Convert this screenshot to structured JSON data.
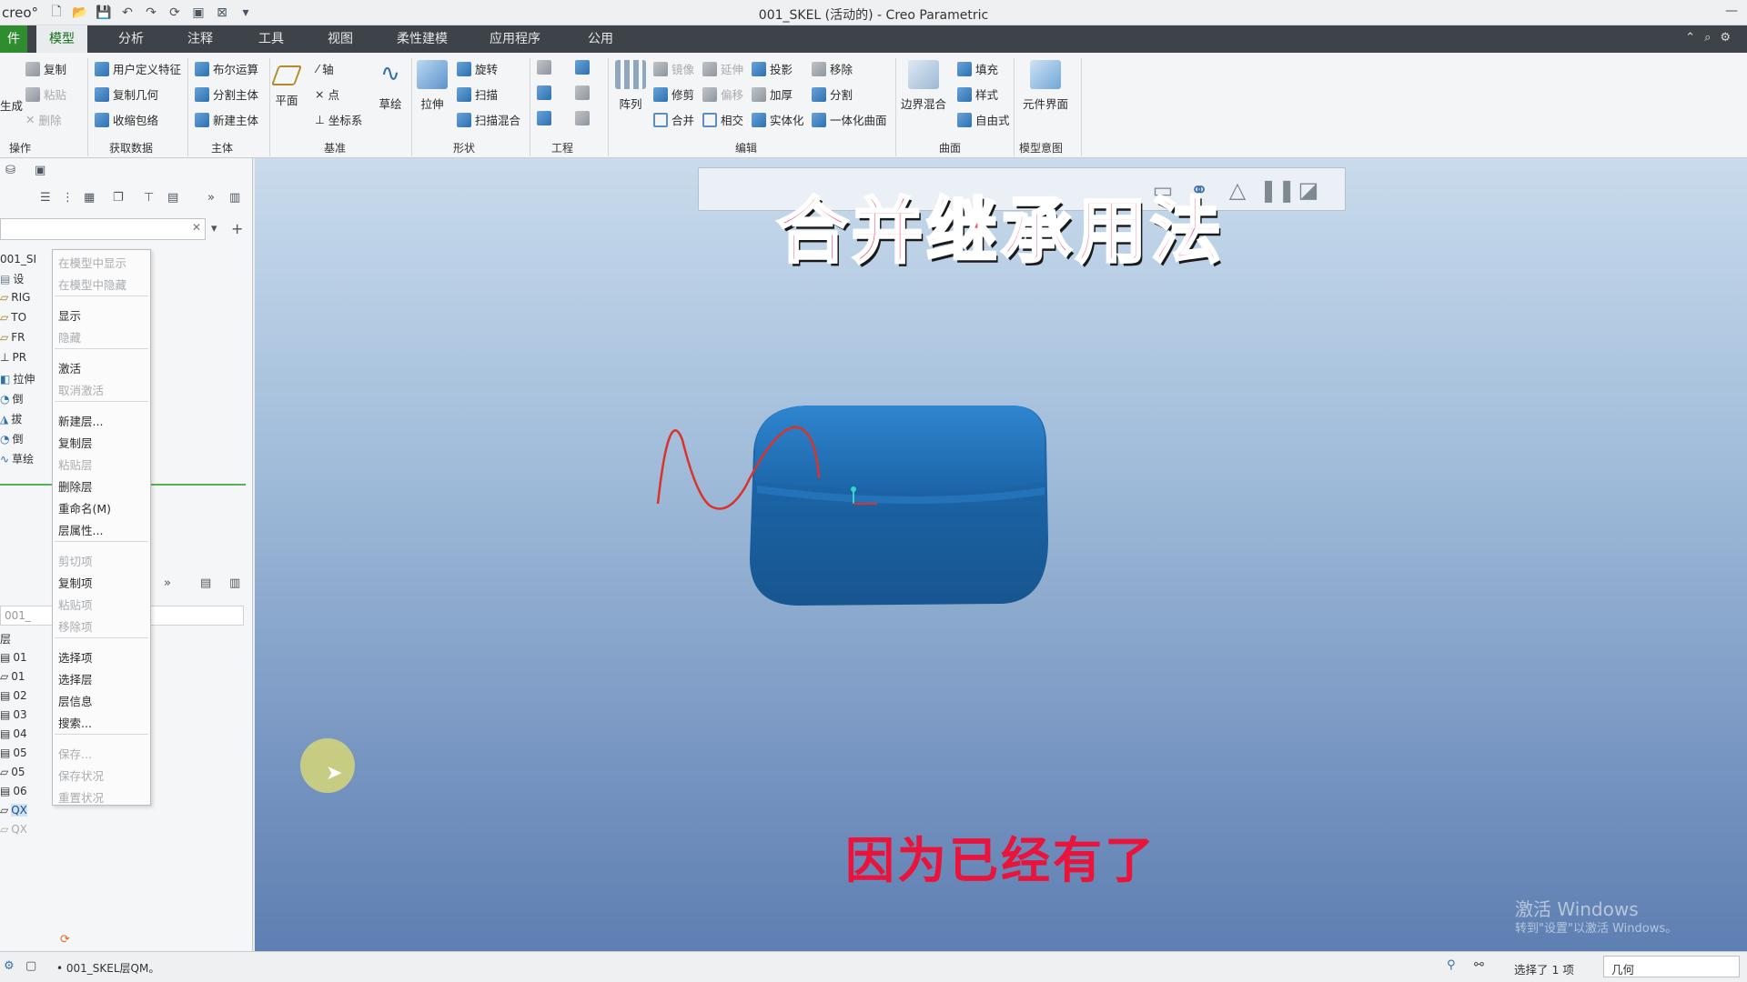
{
  "app": {
    "logo_text": "creo°",
    "window_title": "001_SKEL (活动的) - Creo Parametric"
  },
  "tabs": {
    "file": "件",
    "items": [
      "模型",
      "分析",
      "注释",
      "工具",
      "视图",
      "柔性建模",
      "应用程序",
      "公用"
    ],
    "active": "模型"
  },
  "ribbon": {
    "ops": {
      "regen": "生成",
      "copy": "复制",
      "paste": "粘贴",
      "delete": "删除",
      "label": "操作"
    },
    "get_data": {
      "udf": "用户定义特征",
      "copy_geom": "复制几何",
      "shrinkwrap": "收缩包络",
      "label": "获取数据"
    },
    "body": {
      "boolean": "布尔运算",
      "split_body": "分割主体",
      "new_body": "新建主体",
      "label": "主体"
    },
    "datum": {
      "plane": "平面",
      "axis": "轴",
      "point": "点",
      "csys": "坐标系",
      "sketch": "草绘",
      "label": "基准"
    },
    "shapes": {
      "extrude": "拉伸",
      "revolve": "旋转",
      "sweep": "扫描",
      "swept_blend": "扫描混合",
      "label": "形状"
    },
    "engineering": {
      "label": "工程"
    },
    "editing": {
      "pattern": "阵列",
      "mirror": "镜像",
      "extend": "延伸",
      "project": "投影",
      "trim": "修剪",
      "offset": "偏移",
      "thicken": "加厚",
      "merge": "合并",
      "intersect": "相交",
      "solidify": "实体化",
      "remove": "移除",
      "split": "分割",
      "unify": "一体化曲面",
      "label": "编辑"
    },
    "surfaces": {
      "boundary": "边界混合",
      "fill": "填充",
      "style": "样式",
      "freestyle": "自由式",
      "label": "曲面"
    },
    "model_intent": {
      "component_interface": "元件界面",
      "label": "模型意图"
    }
  },
  "tree": {
    "root": "001_SI",
    "rows": [
      "设",
      "RIG",
      "TO",
      "FR",
      "PR",
      "拉伸",
      "倒",
      "拔",
      "倒",
      "草绘"
    ],
    "layer_header": "层",
    "layer_select": "001_",
    "layers": [
      "01",
      "01",
      "02",
      "03",
      "04",
      "05",
      "05",
      "06",
      "QX",
      "QX"
    ]
  },
  "context_menu": {
    "items": [
      {
        "label": "在模型中显示",
        "enabled": false
      },
      {
        "label": "在模型中隐藏",
        "enabled": false
      },
      {
        "label": "显示",
        "enabled": true
      },
      {
        "label": "隐藏",
        "enabled": false
      },
      {
        "label": "激活",
        "enabled": true
      },
      {
        "label": "取消激活",
        "enabled": false
      },
      {
        "label": "新建层...",
        "enabled": true
      },
      {
        "label": "复制层",
        "enabled": true
      },
      {
        "label": "粘贴层",
        "enabled": false
      },
      {
        "label": "删除层",
        "enabled": true
      },
      {
        "label": "重命名(M)",
        "enabled": true
      },
      {
        "label": "层属性...",
        "enabled": true
      },
      {
        "label": "剪切项",
        "enabled": false
      },
      {
        "label": "复制项",
        "enabled": true
      },
      {
        "label": "粘贴项",
        "enabled": false
      },
      {
        "label": "移除项",
        "enabled": false
      },
      {
        "label": "选择项",
        "enabled": true
      },
      {
        "label": "选择层",
        "enabled": true
      },
      {
        "label": "层信息",
        "enabled": true
      },
      {
        "label": "搜索...",
        "enabled": true
      },
      {
        "label": "保存...",
        "enabled": false
      },
      {
        "label": "保存状况",
        "enabled": false
      },
      {
        "label": "重置状况",
        "enabled": false
      }
    ]
  },
  "overlay": {
    "title": "合并继承用法",
    "subtitle": "因为已经有了"
  },
  "watermark": {
    "line1": "激活 Windows",
    "line2": "转到\"设置\"以激活 Windows。"
  },
  "status": {
    "message": "• 001_SKEL层QM。",
    "selection": "选择了 1 项",
    "filter": "几何"
  },
  "colors": {
    "file_tab": "#2f8c2f",
    "model_body": "#1f6fb4",
    "curve": "#d8332c",
    "title_text": "#f0567a",
    "subtitle_text": "#e8143c"
  }
}
